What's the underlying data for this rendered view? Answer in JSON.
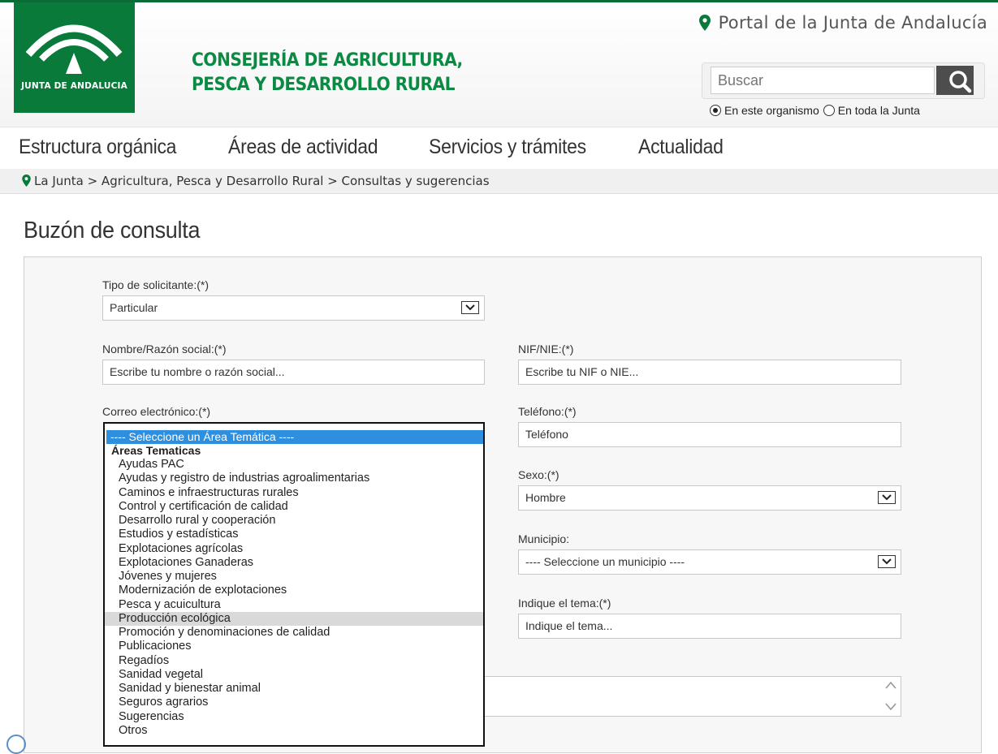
{
  "header": {
    "logo_text": "JUNTA DE ANDALUCIA",
    "consejeria_line1": "CONSEJERÍA DE AGRICULTURA,",
    "consejeria_line2": "PESCA Y DESARROLLO RURAL",
    "portal_link": "Portal de la Junta de Andalucía",
    "search_placeholder": "Buscar",
    "search_icon": "search-icon",
    "radio_this": "En este organismo",
    "radio_all": "En toda la Junta",
    "radio_selected": "En este organismo"
  },
  "nav": {
    "items": [
      "Estructura orgánica",
      "Áreas de actividad",
      "Servicios y trámites",
      "Actualidad"
    ]
  },
  "breadcrumb": {
    "trail": "La Junta > Agricultura, Pesca y Desarrollo Rural > Consultas y sugerencias"
  },
  "page_title": "Buzón de consulta",
  "form": {
    "tipo_label": "Tipo de solicitante:(*)",
    "tipo_value": "Particular",
    "nombre_label": "Nombre/Razón social:(*)",
    "nombre_placeholder": "Escribe tu nombre o razón social...",
    "nif_label": "NIF/NIE:(*)",
    "nif_placeholder": "Escribe tu NIF o NIE...",
    "correo_label": "Correo electrónico:(*)",
    "telefono_label": "Teléfono:(*)",
    "telefono_placeholder": "Teléfono",
    "sexo_label": "Sexo:(*)",
    "sexo_value": "Hombre",
    "municipio_label": "Municipio:",
    "municipio_value": "---- Seleccione un municipio ----",
    "tema_label": "Indique el tema:(*)",
    "tema_placeholder": "Indique el tema..."
  },
  "area_dropdown": {
    "selected": "---- Seleccione un Área Temática ----",
    "group_label": "Áreas Tematicas",
    "hovered": "Producción ecológica",
    "options": [
      "Ayudas PAC",
      "Ayudas y registro de industrias agroalimentarias",
      "Caminos e infraestructuras rurales",
      "Control y certificación de calidad",
      "Desarrollo rural y cooperación",
      "Estudios y estadísticas",
      "Explotaciones agrícolas",
      "Explotaciones Ganaderas",
      "Jóvenes y mujeres",
      "Modernización de explotaciones",
      "Pesca y acuicultura",
      "Producción ecológica",
      "Promoción y denominaciones de calidad",
      "Publicaciones",
      "Regadíos",
      "Sanidad vegetal",
      "Sanidad y bienestar animal",
      "Seguros agrarios",
      "Sugerencias",
      "Otros"
    ]
  },
  "colors": {
    "brand_green": "#0a7a3b",
    "title_green": "#0b8a44",
    "selection_blue": "#2e8fde"
  }
}
